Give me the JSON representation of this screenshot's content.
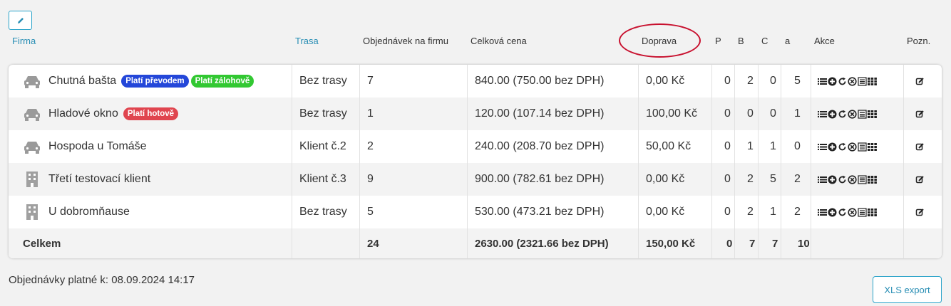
{
  "header": {
    "firma": "Firma",
    "trasa": "Trasa",
    "objednavek": "Objednávek na firmu",
    "celkova": "Celková cena",
    "doprava": "Doprava",
    "p": "P",
    "b": "B",
    "c": "C",
    "a": "a",
    "akce": "Akce",
    "pozn": "Pozn."
  },
  "rows": [
    {
      "icon": "car",
      "name": "Chutná bašta",
      "badges": [
        {
          "text": "Platí převodem",
          "color": "#2447d9"
        },
        {
          "text": "Platí zálohově",
          "color": "#32c832"
        }
      ],
      "trasa": "Bez trasy",
      "objednavek": "7",
      "cena": "840.00 (750.00 bez DPH)",
      "doprava": "0,00 Kč",
      "p": "0",
      "b": "2",
      "c": "0",
      "a": "5"
    },
    {
      "icon": "car",
      "name": "Hladové okno",
      "badges": [
        {
          "text": "Platí hotově",
          "color": "#e0454f"
        }
      ],
      "trasa": "Bez trasy",
      "objednavek": "1",
      "cena": "120.00 (107.14 bez DPH)",
      "doprava": "100,00 Kč",
      "p": "0",
      "b": "0",
      "c": "0",
      "a": "1"
    },
    {
      "icon": "car",
      "name": "Hospoda u Tomáše",
      "badges": [],
      "trasa": "Klient č.2",
      "objednavek": "2",
      "cena": "240.00 (208.70 bez DPH)",
      "doprava": "50,00 Kč",
      "p": "0",
      "b": "1",
      "c": "1",
      "a": "0"
    },
    {
      "icon": "building",
      "name": "Třetí testovací klient",
      "badges": [],
      "trasa": "Klient č.3",
      "objednavek": "9",
      "cena": "900.00 (782.61 bez DPH)",
      "doprava": "0,00 Kč",
      "p": "0",
      "b": "2",
      "c": "5",
      "a": "2"
    },
    {
      "icon": "building",
      "name": "U dobromňause",
      "badges": [],
      "trasa": "Bez trasy",
      "objednavek": "5",
      "cena": "530.00 (473.21 bez DPH)",
      "doprava": "0,00 Kč",
      "p": "0",
      "b": "2",
      "c": "1",
      "a": "2"
    }
  ],
  "total": {
    "label": "Celkem",
    "objednavek": "24",
    "cena": "2630.00 (2321.66 bez DPH)",
    "doprava": "150,00 Kč",
    "p": "0",
    "b": "7",
    "c": "7",
    "a": "10"
  },
  "footer": {
    "valid_text": "Objednávky platné k: 08.09.2024 14:17",
    "xls_label": "XLS export"
  },
  "colors": {
    "accent": "#2a8fb5",
    "highlight_circle": "#c8102e"
  }
}
